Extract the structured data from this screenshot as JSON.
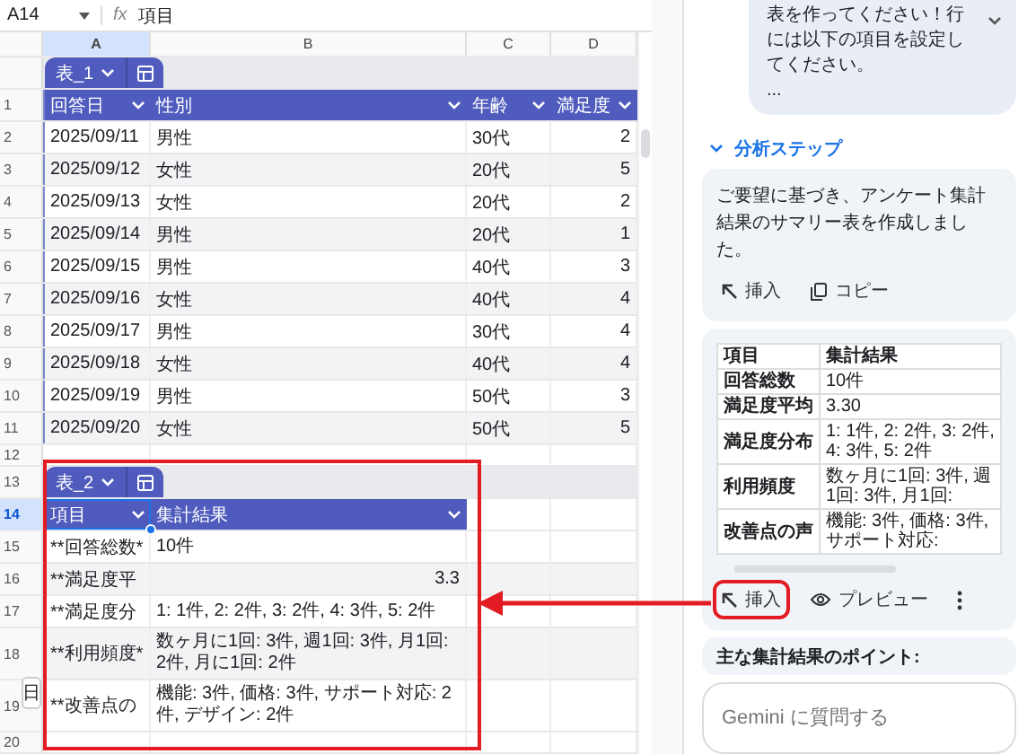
{
  "formula_bar": {
    "cell_ref": "A14",
    "function_label": "fx",
    "value": "項目"
  },
  "column_headers": [
    {
      "label": "A",
      "selected": true
    },
    {
      "label": "B",
      "selected": false
    },
    {
      "label": "C",
      "selected": false
    },
    {
      "label": "D",
      "selected": false
    }
  ],
  "sheet_rows": [
    {
      "kind": "tab",
      "table": "表_1"
    },
    {
      "kind": "header",
      "number": "1",
      "selected": false,
      "cells": [
        {
          "text": "回答日",
          "selected": false
        },
        {
          "text": "性別",
          "selected": false
        },
        {
          "text": "年齢",
          "selected": false
        },
        {
          "text": "満足度",
          "selected": false
        }
      ]
    },
    {
      "kind": "data",
      "number": "2",
      "selected": false,
      "cells": [
        "2025/09/11",
        "男性",
        "30代",
        "2"
      ]
    },
    {
      "kind": "data",
      "number": "3",
      "selected": false,
      "cells": [
        "2025/09/12",
        "女性",
        "20代",
        "5"
      ]
    },
    {
      "kind": "data",
      "number": "4",
      "selected": false,
      "cells": [
        "2025/09/13",
        "女性",
        "20代",
        "2"
      ]
    },
    {
      "kind": "data",
      "number": "5",
      "selected": false,
      "cells": [
        "2025/09/14",
        "男性",
        "20代",
        "1"
      ]
    },
    {
      "kind": "data",
      "number": "6",
      "selected": false,
      "cells": [
        "2025/09/15",
        "男性",
        "40代",
        "3"
      ]
    },
    {
      "kind": "data",
      "number": "7",
      "selected": false,
      "cells": [
        "2025/09/16",
        "女性",
        "40代",
        "4"
      ]
    },
    {
      "kind": "data",
      "number": "8",
      "selected": false,
      "cells": [
        "2025/09/17",
        "男性",
        "30代",
        "4"
      ]
    },
    {
      "kind": "data",
      "number": "9",
      "selected": false,
      "cells": [
        "2025/09/18",
        "女性",
        "40代",
        "4"
      ]
    },
    {
      "kind": "data",
      "number": "10",
      "selected": false,
      "cells": [
        "2025/09/19",
        "男性",
        "50代",
        "3"
      ]
    },
    {
      "kind": "data",
      "number": "11",
      "selected": false,
      "cells": [
        "2025/09/20",
        "女性",
        "50代",
        "5"
      ]
    },
    {
      "kind": "empty",
      "number": "12",
      "selected": false
    },
    {
      "kind": "tab",
      "number": "13",
      "selected": false,
      "table": "表_2"
    },
    {
      "kind": "header",
      "number": "14",
      "selected": true,
      "cells": [
        {
          "text": "項目",
          "selected": true
        },
        {
          "text": "集計結果",
          "selected": false
        }
      ]
    },
    {
      "kind": "data",
      "number": "15",
      "selected": false,
      "cells": [
        "**回答総数*",
        "10件"
      ]
    },
    {
      "kind": "data",
      "number": "16",
      "selected": false,
      "numeric": true,
      "cells": [
        "**満足度平",
        "3.3"
      ]
    },
    {
      "kind": "data",
      "number": "17",
      "selected": false,
      "cells": [
        "**満足度分",
        "1: 1件, 2: 2件, 3: 2件, 4: 3件, 5: 2件"
      ]
    },
    {
      "kind": "data",
      "number": "18",
      "selected": false,
      "cells": [
        "**利用頻度*",
        "数ヶ月に1回: 3件, 週1回: 3件, 月1回: 2件, 月に1回: 2件"
      ]
    },
    {
      "kind": "data",
      "number": "19",
      "selected": false,
      "cells": [
        "**改善点の",
        "機能: 3件, 価格: 3件, サポート対応: 2件, デザイン: 2件"
      ]
    },
    {
      "kind": "empty",
      "number": "20",
      "selected": false
    }
  ],
  "floating_chip": "日",
  "annotation": {
    "highlight_table": true,
    "arrow": true
  },
  "chat": {
    "user_message": {
      "text": "表を作ってください！行には以下の項目を設定してください。",
      "ellipsis": "..."
    },
    "steps": {
      "label": "分析ステップ",
      "expanded": false
    },
    "response_1": {
      "text": "ご要望に基づき、アンケート集計結果のサマリー表を作成しました。",
      "actions": [
        {
          "kind": "insert",
          "label": "挿入",
          "highlighted": false
        },
        {
          "kind": "copy",
          "label": "コピー",
          "highlighted": false
        }
      ]
    },
    "response_2": {
      "table": {
        "columns": [
          "項目",
          "集計結果"
        ],
        "rows": [
          [
            "回答総数",
            "10件"
          ],
          [
            "満足度平均",
            "3.30"
          ],
          [
            "満足度分布",
            "1: 1件, 2: 2件, 3: 2件, 4: 3件, 5: 2件"
          ],
          [
            "利用頻度",
            "数ヶ月に1回: 3件, 週1回: 3件, 月1回:"
          ],
          [
            "改善点の声",
            "機能: 3件, 価格: 3件, サポート対応:"
          ]
        ]
      },
      "actions": [
        {
          "kind": "insert",
          "label": "挿入",
          "highlighted": true
        },
        {
          "kind": "preview",
          "label": "プレビュー",
          "highlighted": false
        },
        {
          "kind": "more",
          "highlighted": false
        }
      ]
    },
    "response_3": {
      "text": "主な集計結果のポイント:"
    },
    "input": {
      "placeholder": "Gemini に質問する"
    }
  }
}
